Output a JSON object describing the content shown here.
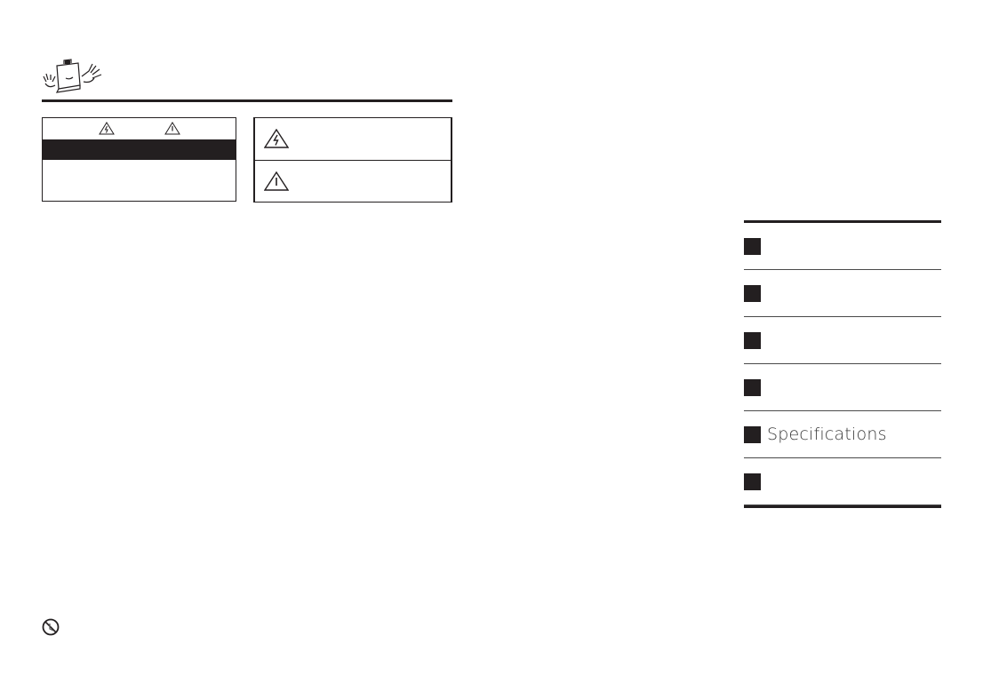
{
  "header": {
    "mascot_icon": "monitor-mascot-waving-icon"
  },
  "warning_box_left": {
    "icons": [
      "electric-shock-warning-icon",
      "caution-exclamation-icon"
    ],
    "heading_bar": "",
    "body_text": ""
  },
  "warning_box_right": {
    "rows": [
      {
        "icon": "electric-shock-warning-icon",
        "text": ""
      },
      {
        "icon": "caution-exclamation-icon",
        "text": ""
      }
    ]
  },
  "toc": {
    "items": [
      {
        "label": ""
      },
      {
        "label": ""
      },
      {
        "label": ""
      },
      {
        "label": ""
      },
      {
        "label": "Specifications"
      },
      {
        "label": ""
      }
    ]
  },
  "footer": {
    "prohibition_icon": "do-not-disassemble-icon"
  }
}
